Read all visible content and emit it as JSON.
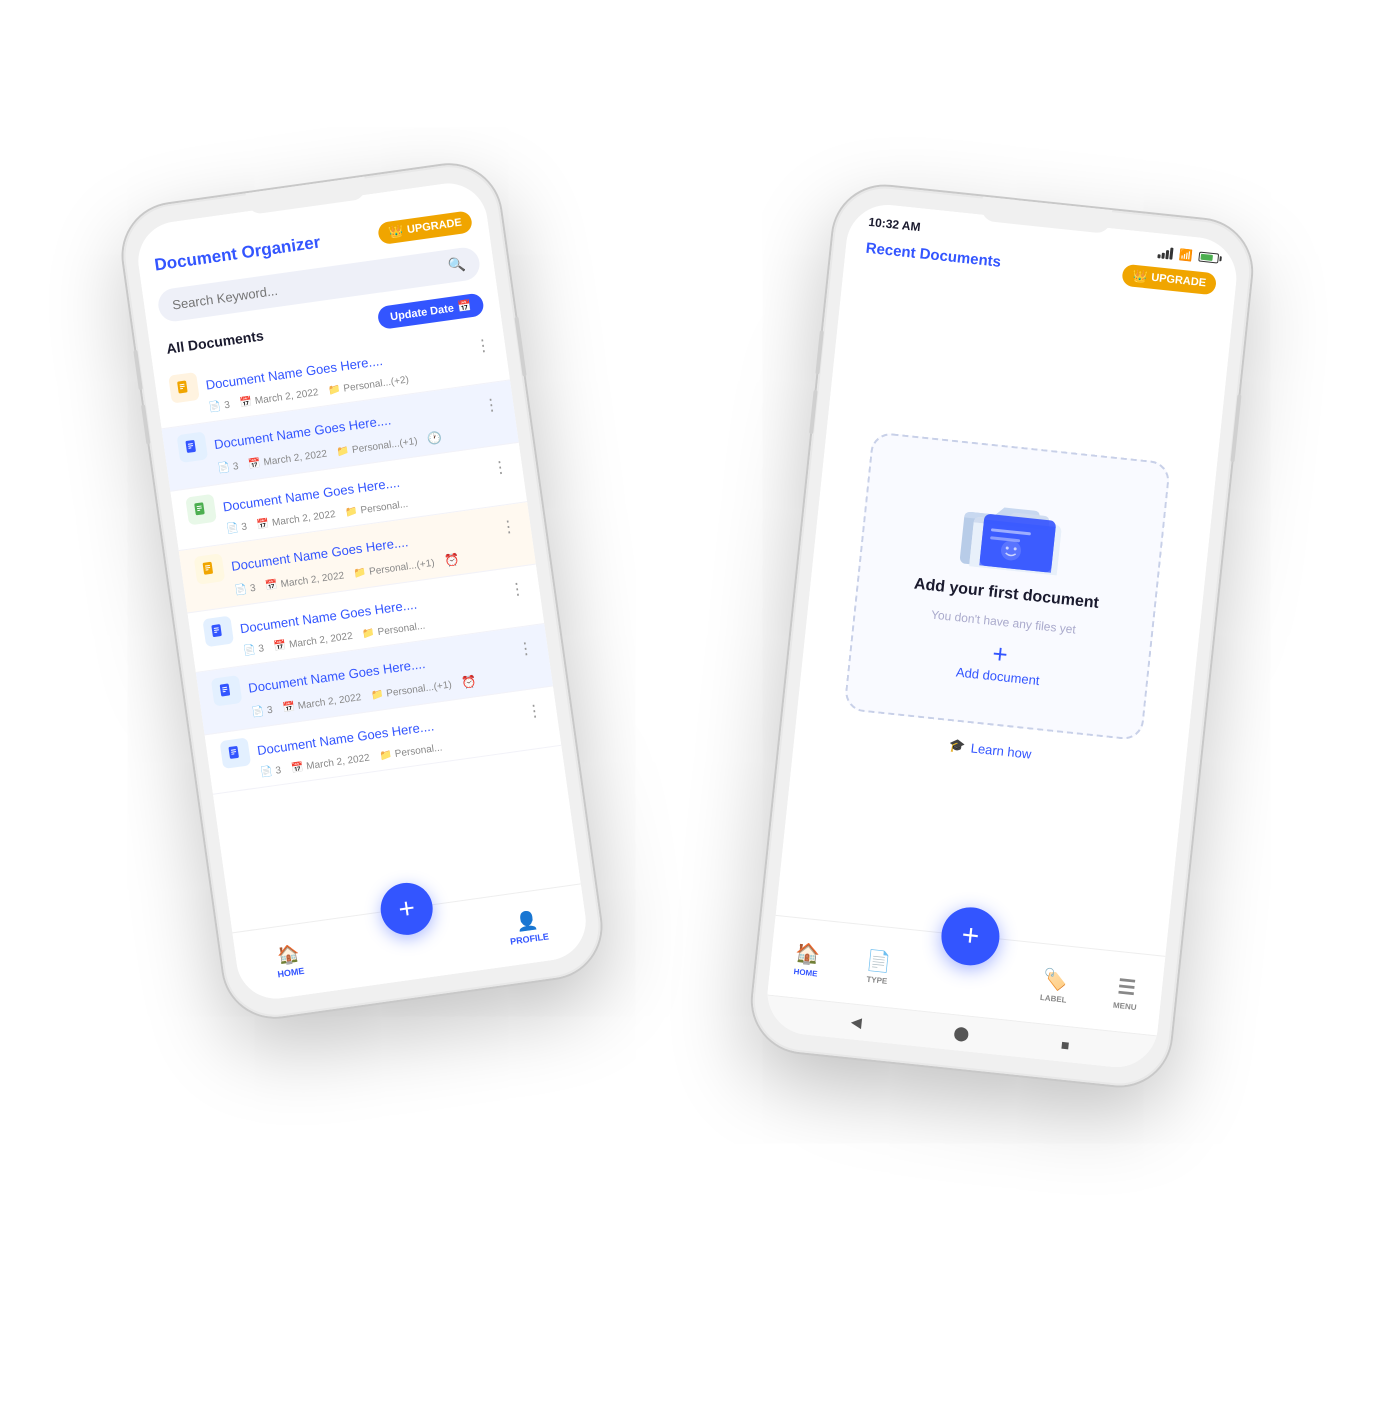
{
  "left_phone": {
    "header": {
      "title": "Document Organizer",
      "upgrade_label": "UPGRADE"
    },
    "search": {
      "placeholder": "Search Keyword..."
    },
    "section_title": "All Documents",
    "update_date_label": "Update Date",
    "documents": [
      {
        "name": "Document Name Goes Here....",
        "pages": "3",
        "date": "March 2, 2022",
        "folder": "Personal...(+2)",
        "icon_color": "orange",
        "icon": "📄",
        "has_alarm": false
      },
      {
        "name": "Document Name Goes Here....",
        "pages": "3",
        "date": "March 2, 2022",
        "folder": "Personal...(+1)",
        "icon_color": "blue",
        "icon": "📋",
        "has_alarm": true
      },
      {
        "name": "Document Name Goes Here....",
        "pages": "3",
        "date": "March 2, 2022",
        "folder": "Personal...",
        "icon_color": "green",
        "icon": "📝",
        "has_alarm": false
      },
      {
        "name": "Document Name Goes Here....",
        "pages": "3",
        "date": "March 2, 2022",
        "folder": "Personal...(+1)",
        "icon_color": "yellow",
        "icon": "📄",
        "has_alarm": true
      },
      {
        "name": "Document Name Goes Here....",
        "pages": "3",
        "date": "March 2, 2022",
        "folder": "Personal...",
        "icon_color": "blue",
        "icon": "📋",
        "has_alarm": false
      },
      {
        "name": "Document Name Goes Here....",
        "pages": "3",
        "date": "March 2, 2022",
        "folder": "Personal...(+1)",
        "icon_color": "blue",
        "icon": "📋",
        "has_alarm": true
      },
      {
        "name": "Document Name Goes Here....",
        "pages": "3",
        "date": "March 2, 2022",
        "folder": "Personal...",
        "icon_color": "blue",
        "icon": "📋",
        "has_alarm": false
      }
    ],
    "nav": {
      "home": "HOME",
      "profile": "PROFILE",
      "fab": "+"
    }
  },
  "right_phone": {
    "status_bar": {
      "time": "10:32 AM",
      "upgrade_label": "UPGRADE"
    },
    "header": {
      "title": "Recent Documents"
    },
    "empty_state": {
      "title": "Add your first document",
      "subtitle": "You don't have any files yet",
      "add_label": "Add document",
      "plus": "+"
    },
    "learn_how": "Learn how",
    "nav": {
      "home": "HOME",
      "type": "TYPE",
      "label": "LABEL",
      "menu": "MENU",
      "fab": "+"
    }
  },
  "colors": {
    "primary": "#3355ff",
    "upgrade": "#f0a500",
    "text_dark": "#1a1a2e",
    "text_muted": "#aaaacc",
    "border": "#c8d0e8"
  }
}
